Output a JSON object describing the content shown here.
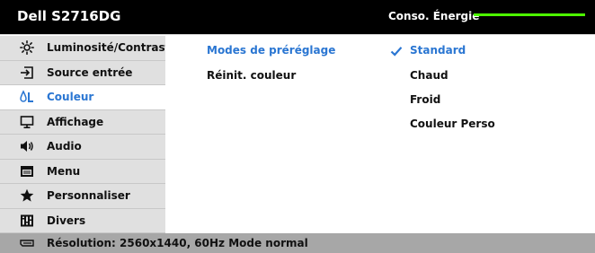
{
  "title_bar": {
    "model": "Dell S2716DG",
    "energy_label": "Conso. Énergie",
    "energy_level": 1.0,
    "energy_color": "#4dff00"
  },
  "sidebar": {
    "items": [
      {
        "label": "Luminosité/Contraste",
        "icon": "brightness-icon"
      },
      {
        "label": "Source entrée",
        "icon": "input-source-icon"
      },
      {
        "label": "Couleur",
        "icon": "color-icon",
        "selected": true
      },
      {
        "label": "Affichage",
        "icon": "display-icon"
      },
      {
        "label": "Audio",
        "icon": "speaker-icon"
      },
      {
        "label": "Menu",
        "icon": "menu-icon"
      },
      {
        "label": "Personnaliser",
        "icon": "star-icon"
      },
      {
        "label": "Divers",
        "icon": "others-icon"
      }
    ]
  },
  "panel": {
    "options": [
      {
        "label": "Modes de préréglage",
        "active": true
      },
      {
        "label": "Réinit. couleur"
      }
    ],
    "presets": [
      {
        "label": "Standard",
        "selected": true
      },
      {
        "label": "Chaud"
      },
      {
        "label": "Froid"
      },
      {
        "label": "Couleur Perso"
      }
    ]
  },
  "status": {
    "text": "Résolution: 2560x1440, 60Hz Mode normal",
    "icon": "dp-connector-icon"
  },
  "colors": {
    "accent": "#2a76d2",
    "frame": "#000000",
    "sidebar": "#e0e0e0",
    "status_bar": "#a7a7a7"
  }
}
